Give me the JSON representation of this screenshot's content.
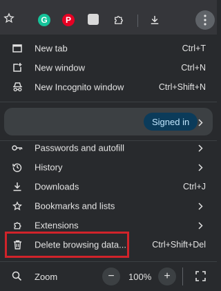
{
  "toolbar": {
    "icons": [
      "star-icon",
      "grammarly-extension-icon",
      "pinterest-extension-icon",
      "extension-icon",
      "puzzle-icon",
      "download-icon",
      "more-vert-icon"
    ],
    "grammarly_letter": "G",
    "pinterest_letter": "P"
  },
  "menu": {
    "new_tab": {
      "label": "New tab",
      "shortcut": "Ctrl+T"
    },
    "new_window": {
      "label": "New window",
      "shortcut": "Ctrl+N"
    },
    "new_incognito": {
      "label": "New Incognito window",
      "shortcut": "Ctrl+Shift+N"
    },
    "profile": {
      "badge": "Signed in"
    },
    "passwords": {
      "label": "Passwords and autofill"
    },
    "history": {
      "label": "History"
    },
    "downloads": {
      "label": "Downloads",
      "shortcut": "Ctrl+J"
    },
    "bookmarks": {
      "label": "Bookmarks and lists"
    },
    "extensions": {
      "label": "Extensions"
    },
    "delete_data": {
      "label": "Delete browsing data...",
      "shortcut": "Ctrl+Shift+Del"
    },
    "zoom": {
      "label": "Zoom",
      "minus": "−",
      "value": "100%",
      "plus": "+"
    }
  },
  "colors": {
    "background": "#282a2d",
    "highlight_border": "#d1232a",
    "signed_in_badge": "#0b3b5a"
  }
}
